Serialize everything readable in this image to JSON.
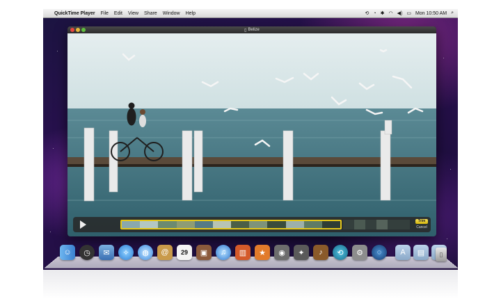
{
  "menubar": {
    "app_name": "QuickTime Player",
    "menus": [
      "File",
      "Edit",
      "View",
      "Share",
      "Window",
      "Help"
    ],
    "clock": "Mon 10:50 AM"
  },
  "window": {
    "title": "Belize"
  },
  "controls": {
    "trim_label": "Trim",
    "cancel_label": "Cancel"
  },
  "dock": {
    "calendar_day": "29",
    "icons": [
      "finder-icon",
      "dashboard-icon",
      "mail-icon",
      "safari-icon",
      "ichat-icon",
      "address-book-icon",
      "ical-icon",
      "iphoto-icon",
      "itunes-icon",
      "ibooks-icon",
      "imovie-icon",
      "iphoto-icon",
      "garageband-icon",
      "time-machine-icon",
      "preferences-icon",
      "mirror-icon",
      "applications-folder-icon",
      "documents-folder-icon",
      "downloads-folder-icon",
      "trash-icon"
    ]
  },
  "colors": {
    "trim_accent": "#e6c81a",
    "sky": "#dce9ea",
    "sea": "#3f6f7d"
  }
}
